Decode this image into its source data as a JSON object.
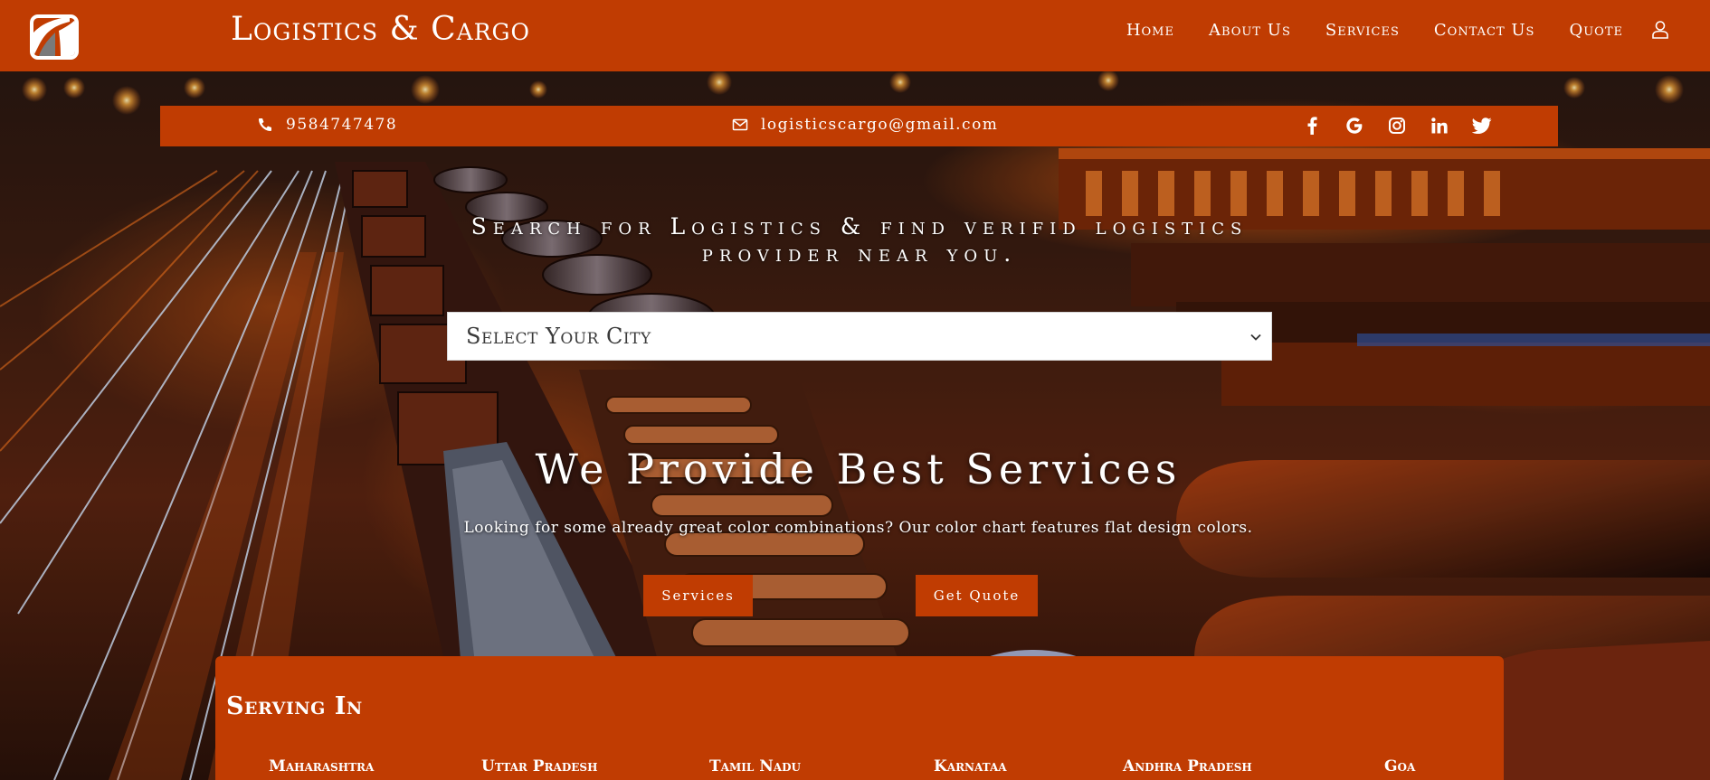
{
  "navbar": {
    "brand": "Logistics & Cargo",
    "items": [
      {
        "label": "Home"
      },
      {
        "label": "About Us"
      },
      {
        "label": "Services"
      },
      {
        "label": "Contact Us"
      },
      {
        "label": "Quote"
      }
    ],
    "user_icon": "user-icon"
  },
  "topbar": {
    "phone": "9584747478",
    "email": "logisticscargo@gmail.com",
    "social": [
      "facebook-icon",
      "google-icon",
      "instagram-icon",
      "linkedin-icon",
      "twitter-icon"
    ]
  },
  "search": {
    "title": "Search for Logistics & find verifid logistics provider near you.",
    "select_value": "Select Your City"
  },
  "hero": {
    "headline": "We Provide Best Services",
    "subline": "Looking for some already great color combinations? Our color chart features flat design colors.",
    "services_button": "Services",
    "quote_button": "Get Quote"
  },
  "serving": {
    "title": "Serving In",
    "states": [
      "Maharashtra",
      "Uttar Pradesh",
      "Tamil Nadu",
      "Karnataa",
      "Andhra Pradesh",
      "Goa"
    ]
  },
  "colors": {
    "accent": "#c03c02",
    "white": "#ffffff"
  }
}
